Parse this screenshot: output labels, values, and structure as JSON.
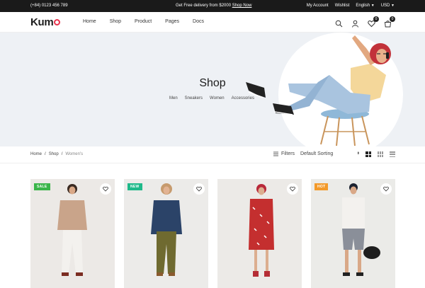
{
  "topbar": {
    "phone": "(+84) 0123 456 789",
    "promo_text": "Get Free delivery from $2000",
    "promo_link": "Shop Now",
    "account": "My Account",
    "wishlist": "Wishlist",
    "language": "English",
    "currency": "USD"
  },
  "header": {
    "logo": "Kum",
    "nav": [
      "Home",
      "Shop",
      "Product",
      "Pages",
      "Docs"
    ],
    "wishlist_count": "0",
    "cart_count": "0"
  },
  "hero": {
    "title": "Shop",
    "categories": [
      "Men",
      "Sneakers",
      "Women",
      "Accessories"
    ]
  },
  "toolbar": {
    "breadcrumb": [
      "Home",
      "Shop",
      "Women's"
    ],
    "separator": "/",
    "filters_label": "Filters",
    "sort_selected": "Default Sorting"
  },
  "products": [
    {
      "tag": "SALE",
      "tag_color": "#3bb54a"
    },
    {
      "tag": "NEW",
      "tag_color": "#1fb98a"
    },
    {
      "tag": "",
      "tag_color": ""
    },
    {
      "tag": "HOT",
      "tag_color": "#f39a2a"
    }
  ],
  "colors": {
    "topbar_bg": "#1a1a1a",
    "hero_bg": "#eef1f5",
    "logo_accent": "#e8334d"
  }
}
